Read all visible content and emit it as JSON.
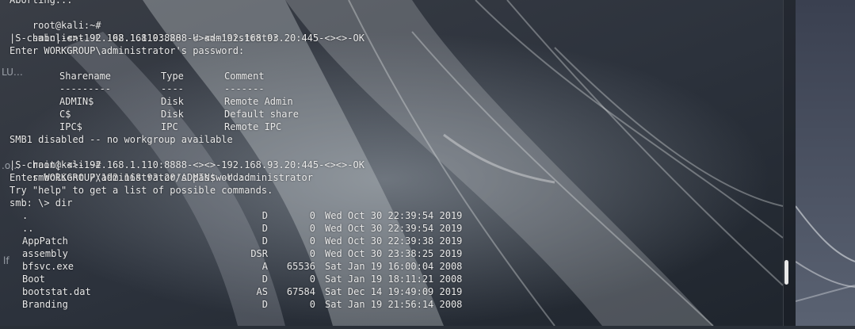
{
  "terminal": {
    "partial_line": "Aborting...",
    "prompt": "root@kali:~#",
    "cmd1": "smbclient -L 192.168.93.20 -U administrator",
    "chain1": "|S-chain|-<>-192.168.1.110:8888-<><>-192.168.93.20:445-<><>-OK",
    "pw_prompt": "Enter WORKGROUP\\administrator's password:",
    "share_headers": [
      "Sharename",
      "Type",
      "Comment"
    ],
    "share_dashes": [
      "---------",
      "----",
      "-------"
    ],
    "shares": [
      {
        "name": "ADMIN$",
        "type": "Disk",
        "comment": "Remote Admin"
      },
      {
        "name": "C$",
        "type": "Disk",
        "comment": "Default share"
      },
      {
        "name": "IPC$",
        "type": "IPC",
        "comment": "Remote IPC"
      }
    ],
    "smb1_msg": "SMB1 disabled -- no workgroup available",
    "cmd2": "smbclient //192.168.93.20/ADMIN$ -U administrator",
    "chain2": "|S-chain|-<>-192.168.1.110:8888-<><>-192.168.93.20:445-<><>-OK",
    "help_msg": "Try \"help\" to get a list of possible commands.",
    "smb_prompt": "smb: \\> dir",
    "files": [
      {
        "name": ".",
        "attr": "D",
        "size": "0",
        "date": "Wed Oct 30 22:39:54 2019"
      },
      {
        "name": "..",
        "attr": "D",
        "size": "0",
        "date": "Wed Oct 30 22:39:54 2019"
      },
      {
        "name": "AppPatch",
        "attr": "D",
        "size": "0",
        "date": "Wed Oct 30 22:39:38 2019"
      },
      {
        "name": "assembly",
        "attr": "DSR",
        "size": "0",
        "date": "Wed Oct 30 23:38:25 2019"
      },
      {
        "name": "bfsvc.exe",
        "attr": "A",
        "size": "65536",
        "date": "Sat Jan 19 16:00:04 2008"
      },
      {
        "name": "Boot",
        "attr": "D",
        "size": "0",
        "date": "Sat Jan 19 18:11:21 2008"
      },
      {
        "name": "bootstat.dat",
        "attr": "AS",
        "size": "67584",
        "date": "Sat Dec 14 19:49:09 2019"
      },
      {
        "name": "Branding",
        "attr": "D",
        "size": "0",
        "date": "Sat Jan 19 21:56:14 2008"
      }
    ]
  },
  "background_fragments": [
    "LU…",
    ".o…",
    "lf"
  ]
}
